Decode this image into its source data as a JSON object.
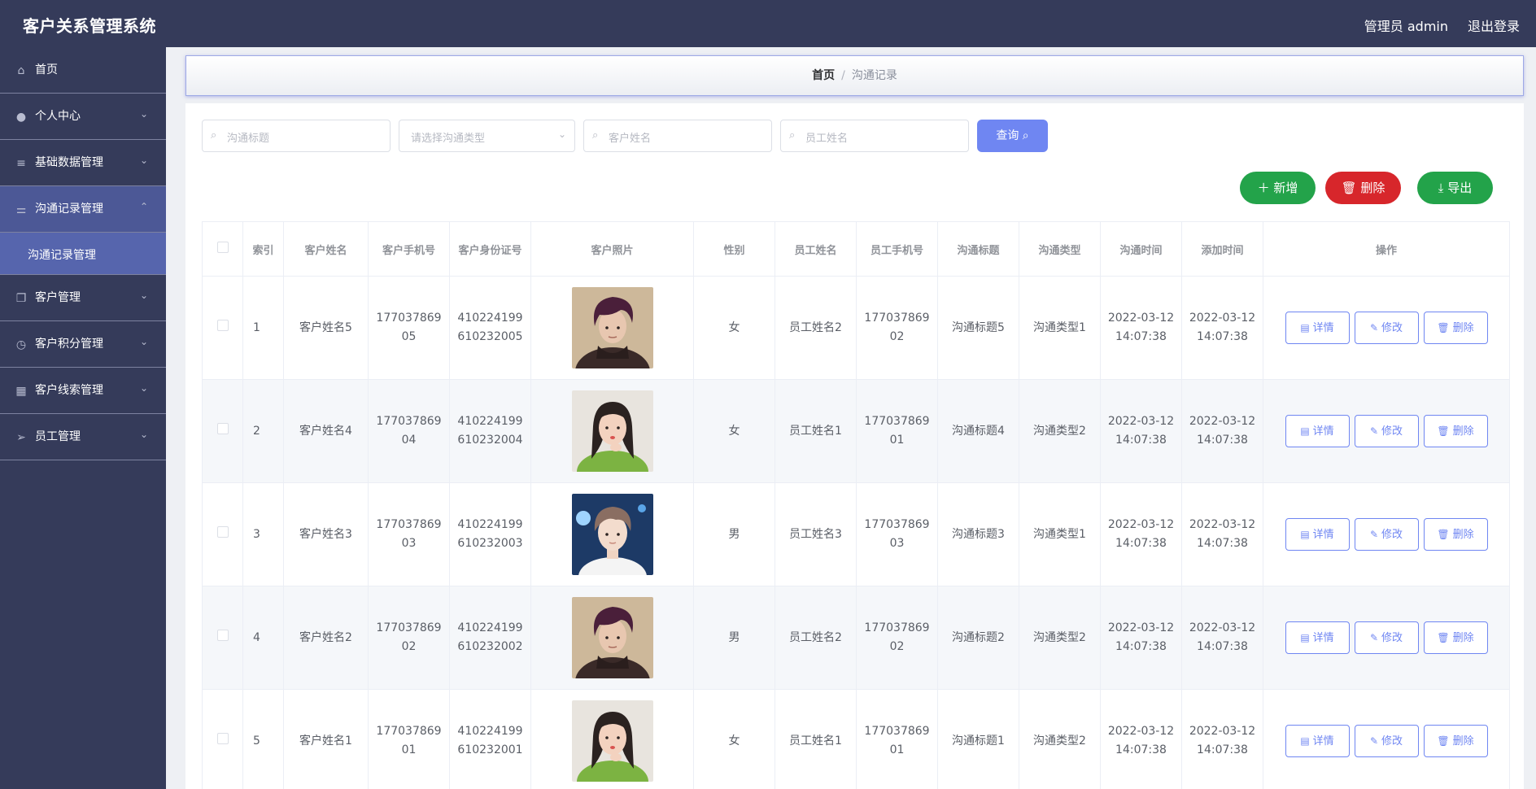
{
  "header": {
    "title": "客户关系管理系统",
    "user": "管理员 admin",
    "logout": "退出登录"
  },
  "sidebar": {
    "items": [
      {
        "icon": "home-icon",
        "glyph": "⌂",
        "label": "首页",
        "chevron": ""
      },
      {
        "icon": "user-icon",
        "glyph": "●",
        "label": "个人中心",
        "chevron": "⌄"
      },
      {
        "icon": "menu-icon",
        "glyph": "≡",
        "label": "基础数据管理",
        "chevron": "⌄"
      },
      {
        "icon": "sliders-icon",
        "glyph": "⚌",
        "label": "沟通记录管理",
        "chevron": "⌃"
      },
      {
        "icon": "copy-icon",
        "glyph": "❐",
        "label": "客户管理",
        "chevron": "⌄"
      },
      {
        "icon": "clock-icon",
        "glyph": "◷",
        "label": "客户积分管理",
        "chevron": "⌄"
      },
      {
        "icon": "grid-icon",
        "glyph": "▦",
        "label": "客户线索管理",
        "chevron": "⌄"
      },
      {
        "icon": "send-icon",
        "glyph": "➢",
        "label": "员工管理",
        "chevron": "⌄"
      }
    ],
    "sub": "沟通记录管理"
  },
  "breadcrumb": {
    "home": "首页",
    "sep": "/",
    "current": "沟通记录"
  },
  "search": {
    "title_ph": "沟通标题",
    "type_ph": "请选择沟通类型",
    "customer_ph": "客户姓名",
    "employee_ph": "员工姓名",
    "query": "查询"
  },
  "actions": {
    "add": "新增",
    "delete": "删除",
    "export": "导出"
  },
  "table": {
    "headers": [
      "索引",
      "客户姓名",
      "客户手机号",
      "客户身份证号",
      "客户照片",
      "性别",
      "员工姓名",
      "员工手机号",
      "沟通标题",
      "沟通类型",
      "沟通时间",
      "添加时间",
      "操作"
    ],
    "ops": {
      "detail": "详情",
      "edit": "修改",
      "delete": "删除"
    },
    "rows": [
      {
        "idx": "1",
        "name": "客户姓名5",
        "phone": [
          "177037869",
          "05"
        ],
        "idcard": [
          "410224199",
          "610232005"
        ],
        "photo": "male-dark",
        "gender": "女",
        "emp": "员工姓名2",
        "emp_phone": [
          "177037869",
          "02"
        ],
        "title": "沟通标题5",
        "type": "沟通类型1",
        "time": [
          "2022-03-12",
          "14:07:38"
        ],
        "added": [
          "2022-03-12",
          "14:07:38"
        ]
      },
      {
        "idx": "2",
        "name": "客户姓名4",
        "phone": [
          "177037869",
          "04"
        ],
        "idcard": [
          "410224199",
          "610232004"
        ],
        "photo": "female-green",
        "gender": "女",
        "emp": "员工姓名1",
        "emp_phone": [
          "177037869",
          "01"
        ],
        "title": "沟通标题4",
        "type": "沟通类型2",
        "time": [
          "2022-03-12",
          "14:07:38"
        ],
        "added": [
          "2022-03-12",
          "14:07:38"
        ]
      },
      {
        "idx": "3",
        "name": "客户姓名3",
        "phone": [
          "177037869",
          "03"
        ],
        "idcard": [
          "410224199",
          "610232003"
        ],
        "photo": "male-blue",
        "gender": "男",
        "emp": "员工姓名3",
        "emp_phone": [
          "177037869",
          "03"
        ],
        "title": "沟通标题3",
        "type": "沟通类型1",
        "time": [
          "2022-03-12",
          "14:07:38"
        ],
        "added": [
          "2022-03-12",
          "14:07:38"
        ]
      },
      {
        "idx": "4",
        "name": "客户姓名2",
        "phone": [
          "177037869",
          "02"
        ],
        "idcard": [
          "410224199",
          "610232002"
        ],
        "photo": "male-dark",
        "gender": "男",
        "emp": "员工姓名2",
        "emp_phone": [
          "177037869",
          "02"
        ],
        "title": "沟通标题2",
        "type": "沟通类型2",
        "time": [
          "2022-03-12",
          "14:07:38"
        ],
        "added": [
          "2022-03-12",
          "14:07:38"
        ]
      },
      {
        "idx": "5",
        "name": "客户姓名1",
        "phone": [
          "177037869",
          "01"
        ],
        "idcard": [
          "410224199",
          "610232001"
        ],
        "photo": "female-green",
        "gender": "女",
        "emp": "员工姓名1",
        "emp_phone": [
          "177037869",
          "01"
        ],
        "title": "沟通标题1",
        "type": "沟通类型2",
        "time": [
          "2022-03-12",
          "14:07:38"
        ],
        "added": [
          "2022-03-12",
          "14:07:38"
        ]
      }
    ]
  },
  "colors": {
    "nav_bg": "#353b5a",
    "nav_active": "#4c5896",
    "sub_active": "#5665ad",
    "primary": "#6f86f2",
    "success": "#23a34a",
    "danger": "#d7262b"
  }
}
